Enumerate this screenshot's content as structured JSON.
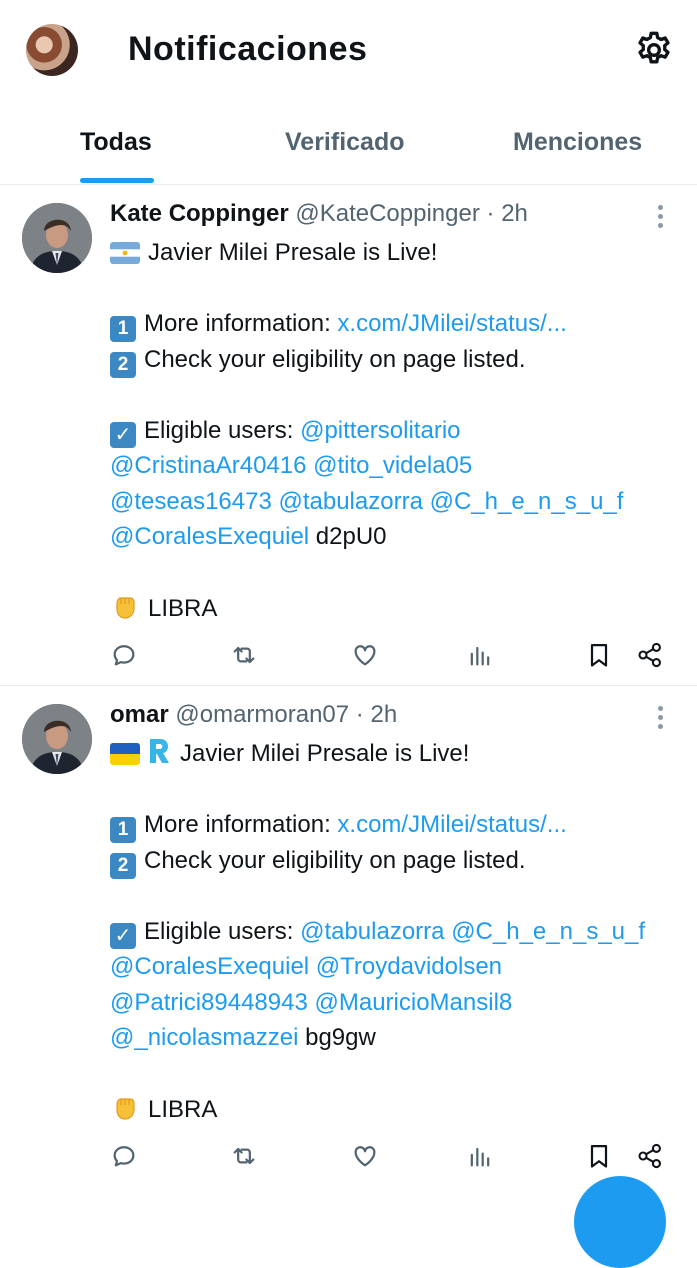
{
  "header": {
    "title": "Notificaciones"
  },
  "tabs": [
    {
      "label": "Todas"
    },
    {
      "label": "Verificado"
    },
    {
      "label": "Menciones"
    }
  ],
  "colors": {
    "accent": "#1d9bf0",
    "text": "#0f1419",
    "secondary": "#536471"
  },
  "tweets": [
    {
      "name": "Kate Coppinger",
      "handle": "@KateCoppinger",
      "sep": "·",
      "time": "2h",
      "line1": "Javier Milei Presale is Live!",
      "info_label": "More information: ",
      "info_link": "x.com/JMilei/status/...",
      "check_text": "Check your eligibility on page listed.",
      "eligible_label": "Eligible users: ",
      "mention1": "@pittersolitario",
      "mention2": "@CristinaAr40416",
      "mention3": "@tito_videla05",
      "mention4": "@teseas16473",
      "mention5": "@tabulazorra",
      "mention6": "@C_h_e_n_s_u_f",
      "mention7": "@CoralesExequiel",
      "code": "d2pU0",
      "footer": "LIBRA"
    },
    {
      "name": "omar",
      "handle": "@omarmoran07",
      "sep": "·",
      "time": "2h",
      "line1": "Javier Milei Presale is Live!",
      "info_label": "More information: ",
      "info_link": "x.com/JMilei/status/...",
      "check_text": "Check your eligibility on page listed.",
      "eligible_label": "Eligible users: ",
      "mention1": "@tabulazorra",
      "mention2": "@C_h_e_n_s_u_f",
      "mention3": "@CoralesExequiel",
      "mention4": "@Troydavidolsen",
      "mention5": "@Patrici89448943",
      "mention6": "@MauricioMansil8",
      "mention7": "@_nicolasmazzei",
      "code": "bg9gw",
      "footer": "LIBRA"
    }
  ],
  "icons": {
    "header": [
      "profile-avatar",
      "gear-icon"
    ],
    "actions": [
      "reply-icon",
      "retweet-icon",
      "like-icon",
      "views-icon",
      "bookmark-icon",
      "share-icon"
    ],
    "emoji": [
      "argentina-flag",
      "ukraine-flag",
      "r-logo",
      "keycap-1",
      "keycap-2",
      "check-box",
      "raised-fist"
    ]
  },
  "keycaps": {
    "one": "1",
    "two": "2",
    "check": "✓"
  }
}
